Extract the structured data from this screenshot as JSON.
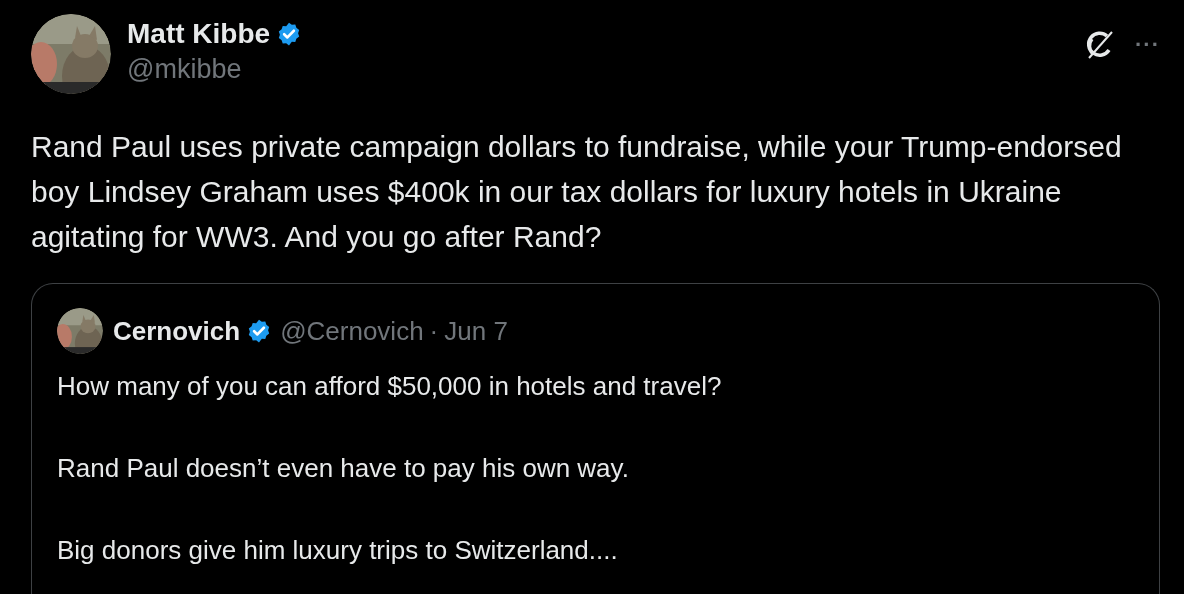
{
  "post": {
    "author": {
      "name": "Matt Kibbe",
      "verified": true,
      "handle": "@mkibbe"
    },
    "text": "Rand Paul uses private campaign dollars to fundraise, while your Trump-endorsed boy Lindsey Graham uses $400k in our tax dollars for luxury hotels in Ukraine agitating for WW3. And you go after Rand?",
    "more_button": "···",
    "quoted_post": {
      "author": {
        "name": "Cernovich",
        "verified": true,
        "handle": "@Cernovich"
      },
      "separator": "·",
      "date": "Jun 7",
      "paragraphs": [
        "How many of you can afford $50,000 in hotels and travel?",
        "Rand Paul doesn’t even have to pay his own way.",
        "Big donors give him luxury trips to Switzerland...."
      ]
    }
  }
}
